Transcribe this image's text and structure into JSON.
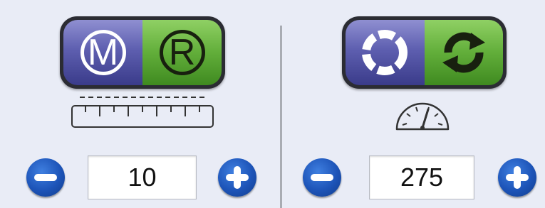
{
  "left_panel": {
    "mode_toggle": {
      "left_letter": "M",
      "right_letter": "R",
      "left_color": "#5e5fb0",
      "right_color": "#62ae3a",
      "left_icon": "m-circle-icon",
      "right_icon": "r-circle-icon"
    },
    "indicator_icon": "ruler-icon",
    "stepper": {
      "value": "10",
      "decrement_icon": "minus-icon",
      "increment_icon": "plus-icon"
    }
  },
  "right_panel": {
    "mode_toggle": {
      "left_icon": "dashed-circle-icon",
      "right_icon": "refresh-arrows-icon",
      "left_color": "#5e5fb0",
      "right_color": "#62ae3a"
    },
    "indicator_icon": "speedometer-icon",
    "stepper": {
      "value": "275",
      "decrement_icon": "minus-icon",
      "increment_icon": "plus-icon"
    }
  },
  "colors": {
    "background": "#e9ecf6",
    "stepper_blue": "#1d54b8"
  }
}
